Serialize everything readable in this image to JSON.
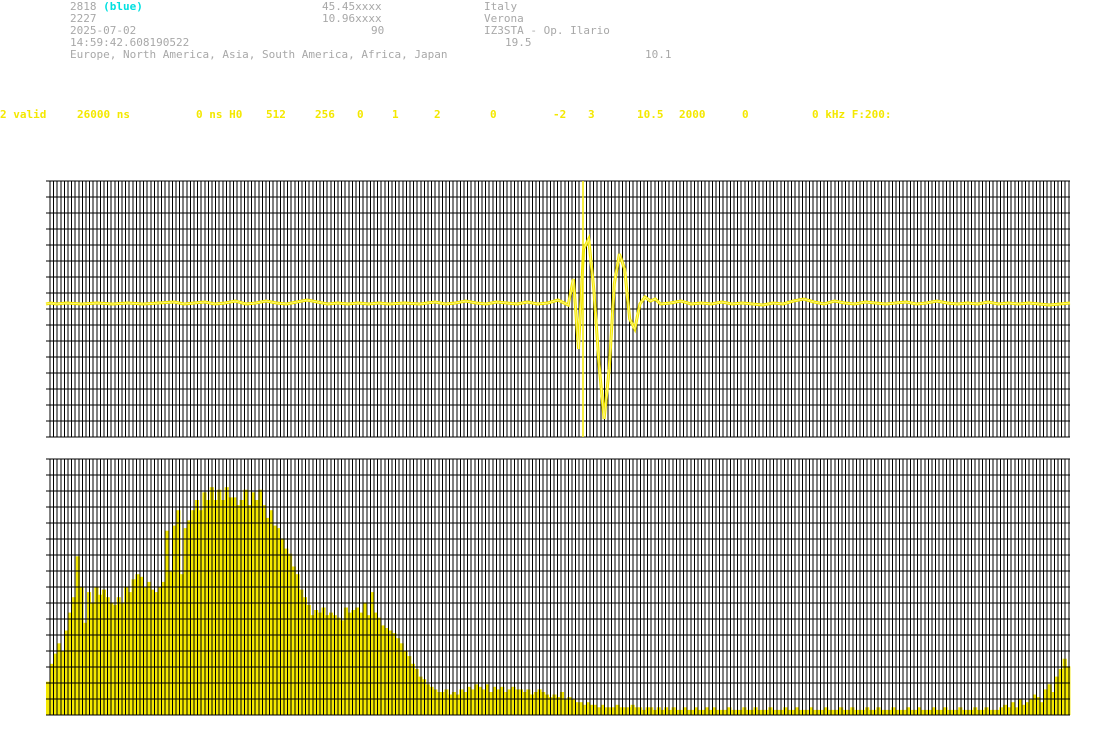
{
  "header": {
    "station_id": "2818",
    "station_color": "(blue)",
    "number": "2227",
    "date": "2025-07-02",
    "time": "14:59:42.608190522",
    "regions": "Europe, North America, Asia, South America, Africa, Japan",
    "lat": "45.45xxxx",
    "lon": "10.96xxxx",
    "value_90": "90",
    "country": "Italy",
    "city": "Verona",
    "operator": "IZ3STA - Op. Ilario",
    "value_19_5": "19.5",
    "value_10_1": "10.1"
  },
  "status_bar": {
    "fields": [
      "2 valid",
      "26000 ns",
      "0 ns H0",
      "512",
      "256",
      "0",
      "1",
      "2",
      "0",
      "-2",
      "3",
      "10.5",
      "2000",
      "0",
      "0 kHz F:200:"
    ]
  },
  "colors": {
    "header_text": "#a8a8a8",
    "highlight": "#00e0e0",
    "signal": "#f4e800",
    "grid": "#000000",
    "background": "#ffffff"
  },
  "chart_data": [
    {
      "type": "line",
      "title": "",
      "grid": true,
      "marker": "vertical cursor at center of pulse",
      "series": [
        {
          "values": [
            0,
            0,
            0,
            0,
            0,
            0,
            0,
            0,
            0,
            0,
            0,
            0,
            0,
            0,
            0,
            0,
            0,
            0,
            0,
            0,
            0,
            0,
            0,
            0,
            0,
            0,
            0,
            0,
            0,
            0,
            0,
            0,
            0,
            0,
            0,
            0,
            0,
            0,
            0,
            0,
            0,
            0,
            0,
            0,
            0,
            0,
            0,
            0,
            0,
            0,
            0,
            0,
            0,
            0,
            0,
            0,
            0,
            0,
            0,
            0,
            0,
            0,
            0,
            0,
            0,
            0,
            0,
            0,
            0,
            0,
            0,
            0,
            0,
            0,
            0,
            0,
            0,
            0,
            0,
            0,
            0,
            0,
            0,
            0,
            0,
            0,
            0,
            0,
            0,
            0,
            0,
            0,
            0,
            0,
            0,
            0,
            0,
            0,
            0,
            0,
            0,
            0,
            0,
            0,
            0,
            0,
            0,
            0,
            0,
            0,
            0,
            0,
            0,
            0,
            0,
            0,
            0,
            0,
            0,
            0,
            0,
            0,
            0,
            0,
            0,
            0,
            0,
            0,
            0,
            0,
            0,
            0,
            0,
            0,
            0,
            0,
            0,
            0,
            0,
            0,
            0,
            0,
            0,
            0,
            0,
            0,
            0,
            0,
            0,
            0,
            0,
            0,
            0,
            0,
            0,
            0,
            0,
            0,
            0,
            0,
            0,
            0,
            0,
            0,
            0,
            0,
            0,
            0,
            0,
            0,
            0,
            0,
            0,
            0,
            0,
            0,
            0,
            0,
            0,
            0,
            0,
            0,
            0,
            0,
            0,
            0,
            0,
            0,
            0,
            0,
            0,
            0,
            0,
            0,
            0,
            0,
            0,
            0,
            0,
            0,
            0,
            0,
            0,
            0,
            0,
            0,
            0,
            0,
            0,
            0,
            0,
            0,
            0,
            0,
            0,
            0,
            0,
            0,
            0,
            0,
            0,
            0,
            0,
            0,
            0,
            0,
            0,
            0,
            0,
            0,
            0,
            0,
            0,
            0,
            0,
            0,
            0,
            0,
            0,
            0,
            0,
            0,
            0,
            0,
            0,
            0,
            0,
            0,
            0,
            0,
            0,
            0,
            0,
            0,
            0,
            0,
            0,
            0,
            0,
            0,
            0,
            0,
            0,
            0,
            0,
            0,
            0,
            0,
            0,
            0,
            0,
            0,
            0,
            0,
            0,
            0,
            0,
            0,
            0,
            0,
            0,
            0,
            0,
            0,
            0,
            0,
            0,
            0,
            0,
            0,
            0,
            0,
            0,
            0,
            0,
            0,
            0,
            0,
            0,
            0,
            0,
            0,
            0,
            0,
            0,
            0,
            0,
            0,
            0,
            0,
            0,
            0,
            0,
            0,
            0,
            0,
            0,
            0,
            0,
            0,
            0,
            0,
            0,
            0,
            0,
            0,
            0,
            0,
            0,
            0,
            0,
            0,
            0,
            0,
            0,
            0,
            0,
            0,
            0,
            0,
            0,
            0,
            0,
            0,
            0,
            0,
            0,
            0,
            0,
            0,
            0,
            0,
            0,
            0,
            0,
            0,
            0,
            0,
            0,
            0,
            0,
            0,
            0,
            0,
            0,
            0,
            0,
            0,
            0,
            0,
            0,
            0,
            0,
            0,
            0,
            0,
            0,
            0,
            0,
            0,
            0,
            0,
            0,
            0,
            0,
            0,
            0,
            0,
            0,
            0,
            0,
            0,
            0,
            0,
            0,
            0,
            0,
            0,
            0,
            0,
            0,
            0,
            0,
            0,
            0,
            0,
            0,
            0,
            0,
            0,
            0,
            0,
            0,
            0,
            0,
            0,
            0,
            0,
            0,
            0,
            0,
            0,
            0,
            0,
            0,
            0,
            0,
            0,
            0,
            0,
            0,
            0,
            0,
            0,
            0,
            0,
            0,
            0,
            0,
            0,
            0,
            0,
            0,
            0,
            0,
            0,
            0,
            0,
            0,
            0,
            0,
            0,
            0,
            0,
            0,
            0,
            0,
            0,
            0,
            0,
            0,
            0,
            0,
            0,
            0,
            0,
            0,
            0,
            0,
            0,
            0,
            0,
            0,
            0,
            0,
            0,
            0,
            0,
            0,
            0,
            0,
            0,
            0,
            0,
            0,
            0,
            0,
            0,
            0,
            0,
            0,
            0,
            0,
            0,
            0,
            0,
            0,
            0,
            0,
            0,
            0,
            0,
            0,
            0,
            0,
            0,
            0,
            0,
            0,
            0,
            0,
            0,
            0,
            0,
            0,
            0,
            0,
            0,
            0,
            0,
            0,
            0,
            0,
            0,
            0,
            0,
            0,
            0,
            0,
            0,
            0,
            0,
            0,
            0,
            0,
            0,
            0,
            0,
            0,
            0,
            0,
            0,
            0,
            0,
            0,
            0,
            0,
            0,
            0,
            0,
            0,
            0
          ]
        }
      ],
      "waveform_points": [
        [
          0,
          0.05
        ],
        [
          2,
          0.06
        ],
        [
          4,
          0.05
        ],
        [
          8,
          0.06
        ],
        [
          14,
          0.05
        ],
        [
          20,
          0.06
        ],
        [
          26,
          0.05
        ],
        [
          32,
          0.06
        ],
        [
          38,
          0.05
        ],
        [
          44,
          0.06
        ],
        [
          50,
          0.07
        ],
        [
          54,
          0.05
        ],
        [
          58,
          0.06
        ],
        [
          62,
          0.07
        ],
        [
          66,
          0.05
        ],
        [
          70,
          0.06
        ],
        [
          74,
          0.08
        ],
        [
          78,
          0.05
        ],
        [
          82,
          0.06
        ],
        [
          86,
          0.08
        ],
        [
          90,
          0.06
        ],
        [
          94,
          0.05
        ],
        [
          98,
          0.07
        ],
        [
          102,
          0.09
        ],
        [
          106,
          0.07
        ],
        [
          110,
          0.05
        ],
        [
          114,
          0.06
        ],
        [
          118,
          0.05
        ],
        [
          122,
          0.06
        ],
        [
          126,
          0.05
        ],
        [
          130,
          0.06
        ],
        [
          134,
          0.05
        ],
        [
          140,
          0.06
        ],
        [
          146,
          0.05
        ],
        [
          152,
          0.07
        ],
        [
          156,
          0.05
        ],
        [
          160,
          0.06
        ],
        [
          164,
          0.08
        ],
        [
          168,
          0.06
        ],
        [
          172,
          0.05
        ],
        [
          176,
          0.07
        ],
        [
          180,
          0.06
        ],
        [
          184,
          0.05
        ],
        [
          188,
          0.07
        ],
        [
          192,
          0.05
        ],
        [
          196,
          0.06
        ],
        [
          200,
          0.09
        ],
        [
          204,
          0.04
        ],
        [
          206,
          0.3
        ],
        [
          208,
          -0.4
        ],
        [
          210,
          0.6
        ],
        [
          212,
          0.7
        ],
        [
          214,
          0.2
        ],
        [
          216,
          -0.55
        ],
        [
          218,
          -1.1
        ],
        [
          220,
          -0.6
        ],
        [
          222,
          0.25
        ],
        [
          224,
          0.55
        ],
        [
          226,
          0.4
        ],
        [
          228,
          -0.1
        ],
        [
          230,
          -0.2
        ],
        [
          232,
          0.05
        ],
        [
          234,
          0.12
        ],
        [
          236,
          0.08
        ],
        [
          238,
          0.1
        ],
        [
          240,
          0.05
        ],
        [
          244,
          0.06
        ],
        [
          248,
          0.08
        ],
        [
          252,
          0.05
        ],
        [
          256,
          0.06
        ],
        [
          260,
          0.05
        ],
        [
          264,
          0.07
        ],
        [
          268,
          0.05
        ],
        [
          272,
          0.06
        ],
        [
          276,
          0.05
        ],
        [
          280,
          0.04
        ],
        [
          284,
          0.06
        ],
        [
          288,
          0.05
        ],
        [
          292,
          0.08
        ],
        [
          296,
          0.1
        ],
        [
          300,
          0.07
        ],
        [
          304,
          0.05
        ],
        [
          308,
          0.08
        ],
        [
          312,
          0.06
        ],
        [
          316,
          0.05
        ],
        [
          320,
          0.07
        ],
        [
          324,
          0.06
        ],
        [
          328,
          0.05
        ],
        [
          332,
          0.06
        ],
        [
          336,
          0.07
        ],
        [
          340,
          0.05
        ],
        [
          344,
          0.06
        ],
        [
          348,
          0.08
        ],
        [
          352,
          0.06
        ],
        [
          356,
          0.05
        ],
        [
          360,
          0.06
        ],
        [
          364,
          0.05
        ],
        [
          368,
          0.07
        ],
        [
          372,
          0.05
        ],
        [
          376,
          0.06
        ],
        [
          380,
          0.05
        ],
        [
          384,
          0.06
        ],
        [
          388,
          0.05
        ],
        [
          392,
          0.04
        ],
        [
          396,
          0.05
        ],
        [
          400,
          0.06
        ]
      ]
    },
    {
      "type": "bar",
      "title": "",
      "grid": true,
      "values": [
        0.13,
        0.2,
        0.24,
        0.28,
        0.25,
        0.33,
        0.4,
        0.46,
        0.62,
        0.5,
        0.36,
        0.48,
        0.44,
        0.5,
        0.47,
        0.49,
        0.46,
        0.44,
        0.43,
        0.46,
        0.44,
        0.5,
        0.48,
        0.53,
        0.55,
        0.54,
        0.5,
        0.52,
        0.49,
        0.48,
        0.5,
        0.52,
        0.72,
        0.56,
        0.74,
        0.8,
        0.55,
        0.73,
        0.76,
        0.8,
        0.84,
        0.8,
        0.87,
        0.84,
        0.89,
        0.84,
        0.88,
        0.84,
        0.89,
        0.85,
        0.85,
        0.82,
        0.84,
        0.88,
        0.82,
        0.87,
        0.84,
        0.88,
        0.82,
        0.77,
        0.8,
        0.74,
        0.73,
        0.69,
        0.65,
        0.63,
        0.58,
        0.55,
        0.49,
        0.46,
        0.43,
        0.39,
        0.41,
        0.4,
        0.42,
        0.39,
        0.4,
        0.39,
        0.38,
        0.37,
        0.42,
        0.4,
        0.41,
        0.42,
        0.4,
        0.44,
        0.39,
        0.48,
        0.4,
        0.38,
        0.35,
        0.34,
        0.33,
        0.32,
        0.3,
        0.28,
        0.25,
        0.23,
        0.2,
        0.18,
        0.15,
        0.14,
        0.12,
        0.11,
        0.1,
        0.09,
        0.09,
        0.1,
        0.08,
        0.09,
        0.08,
        0.1,
        0.09,
        0.11,
        0.1,
        0.12,
        0.11,
        0.1,
        0.12,
        0.09,
        0.11,
        0.1,
        0.11,
        0.09,
        0.1,
        0.11,
        0.1,
        0.1,
        0.09,
        0.1,
        0.08,
        0.09,
        0.1,
        0.09,
        0.08,
        0.07,
        0.08,
        0.07,
        0.09,
        0.06,
        0.07,
        0.06,
        0.05,
        0.05,
        0.04,
        0.05,
        0.04,
        0.04,
        0.03,
        0.04,
        0.03,
        0.03,
        0.03,
        0.04,
        0.03,
        0.03,
        0.03,
        0.04,
        0.03,
        0.03,
        0.02,
        0.03,
        0.03,
        0.02,
        0.03,
        0.02,
        0.03,
        0.02,
        0.03,
        0.02,
        0.02,
        0.03,
        0.02,
        0.02,
        0.03,
        0.02,
        0.02,
        0.03,
        0.02,
        0.03,
        0.02,
        0.02,
        0.02,
        0.03,
        0.02,
        0.02,
        0.02,
        0.03,
        0.02,
        0.02,
        0.03,
        0.02,
        0.02,
        0.02,
        0.03,
        0.02,
        0.02,
        0.02,
        0.03,
        0.02,
        0.02,
        0.03,
        0.02,
        0.02,
        0.02,
        0.03,
        0.02,
        0.02,
        0.02,
        0.03,
        0.02,
        0.02,
        0.02,
        0.03,
        0.02,
        0.02,
        0.03,
        0.02,
        0.02,
        0.02,
        0.03,
        0.02,
        0.02,
        0.03,
        0.02,
        0.02,
        0.02,
        0.03,
        0.02,
        0.02,
        0.02,
        0.03,
        0.02,
        0.02,
        0.03,
        0.02,
        0.02,
        0.02,
        0.03,
        0.02,
        0.02,
        0.03,
        0.02,
        0.02,
        0.02,
        0.03,
        0.02,
        0.02,
        0.02,
        0.03,
        0.02,
        0.02,
        0.03,
        0.02,
        0.02,
        0.02,
        0.03,
        0.04,
        0.03,
        0.05,
        0.03,
        0.06,
        0.04,
        0.05,
        0.06,
        0.08,
        0.07,
        0.05,
        0.1,
        0.12,
        0.09,
        0.15,
        0.18,
        0.22,
        0.19
      ]
    }
  ]
}
